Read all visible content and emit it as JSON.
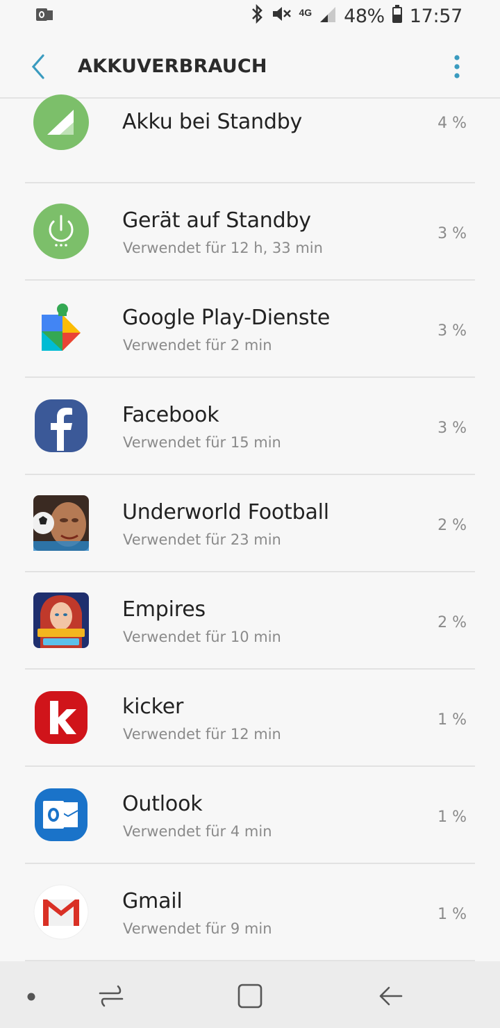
{
  "status_bar": {
    "network": "4G",
    "battery_percent": "48%",
    "time": "17:57",
    "icons": [
      "outlook-notification-icon",
      "bluetooth-icon",
      "mute-icon",
      "signal-icon",
      "battery-icon"
    ]
  },
  "app_bar": {
    "title": "AKKUVERBRAUCH"
  },
  "items": [
    {
      "name": "Akku bei Standby",
      "detail": "",
      "percent": "4 %",
      "icon": "cell-standby-icon",
      "color": "#7cbf6a"
    },
    {
      "name": "Gerät auf Standby",
      "detail": "Verwendet für 12 h, 33 min",
      "percent": "3 %",
      "icon": "device-standby-icon",
      "color": "#7cbf6a"
    },
    {
      "name": "Google Play-Dienste",
      "detail": "Verwendet für 2 min",
      "percent": "3 %",
      "icon": "google-play-services-icon",
      "color": "#34a853"
    },
    {
      "name": "Facebook",
      "detail": "Verwendet für 15 min",
      "percent": "3 %",
      "icon": "facebook-icon",
      "color": "#3b5998"
    },
    {
      "name": "Underworld Football",
      "detail": "Verwendet für 23 min",
      "percent": "2 %",
      "icon": "underworld-football-icon",
      "color": "#5a3b2a"
    },
    {
      "name": "Empires",
      "detail": "Verwendet für 10 min",
      "percent": "2 %",
      "icon": "empires-puzzles-icon",
      "color": "#2b3f8c"
    },
    {
      "name": "kicker",
      "detail": "Verwendet für 12 min",
      "percent": "1 %",
      "icon": "kicker-icon",
      "color": "#d0141a"
    },
    {
      "name": "Outlook",
      "detail": "Verwendet für 4 min",
      "percent": "1 %",
      "icon": "outlook-icon",
      "color": "#1a73c9"
    },
    {
      "name": "Gmail",
      "detail": "Verwendet für 9 min",
      "percent": "1 %",
      "icon": "gmail-icon",
      "color": "#d93025"
    }
  ],
  "nav_bar": {
    "icons": [
      "dot-icon",
      "recents-icon",
      "home-icon",
      "back-icon"
    ]
  },
  "colors": {
    "accent": "#3a9bbf",
    "background": "#f7f7f7",
    "secondary_text": "#8a8a8a"
  }
}
